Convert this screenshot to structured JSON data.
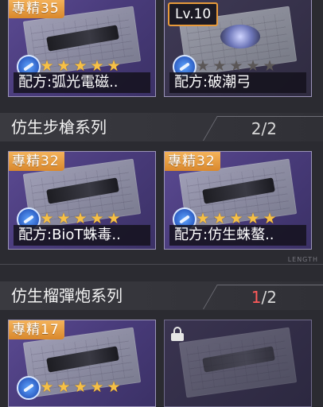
{
  "top_row": [
    {
      "badge": "專精35",
      "stars_on": 5,
      "stars_total": 5,
      "label": "配方:弧光電磁..",
      "kind": "expert"
    },
    {
      "badge": "Lv.10",
      "stars_on": 0,
      "stars_total": 5,
      "label": "配方:破潮弓",
      "kind": "level"
    }
  ],
  "section1": {
    "title": "仿生步槍系列",
    "count_current": "2",
    "count_sep": "/",
    "count_total": "2"
  },
  "row2": [
    {
      "badge": "專精32",
      "stars_on": 5,
      "stars_total": 5,
      "label": "配方:BioT蛛毒..",
      "kind": "expert"
    },
    {
      "badge": "專精32",
      "stars_on": 5,
      "stars_total": 5,
      "label": "配方:仿生蛛螯..",
      "kind": "expert"
    }
  ],
  "length_label": "LENGTH",
  "section2": {
    "title": "仿生榴彈炮系列",
    "count_current": "1",
    "count_sep": "/",
    "count_total": "2"
  },
  "row3": [
    {
      "badge": "專精17",
      "stars_on": 5,
      "stars_total": 5,
      "kind": "expert"
    },
    {
      "kind": "locked"
    }
  ],
  "colors": {
    "accent_orange": "#e89a3a",
    "star_gold": "#f6c046",
    "count_red": "#ff5a5a",
    "card_purple": "#4a3c7c"
  },
  "icons": {
    "star": "★",
    "lock": "lock-icon",
    "recipe": "blueprint-icon"
  }
}
